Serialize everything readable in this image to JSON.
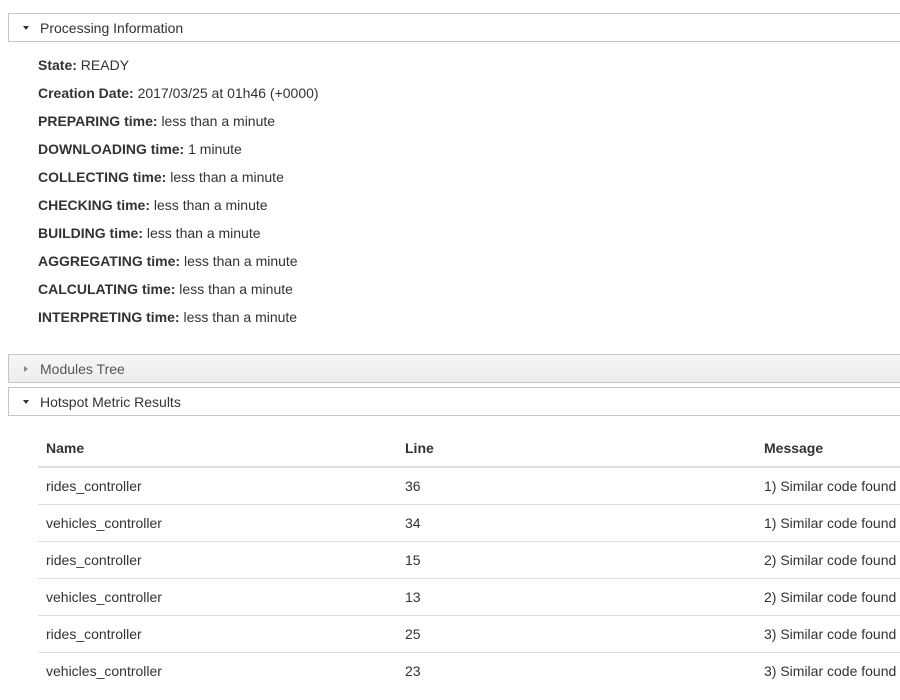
{
  "processing": {
    "title": "Processing Information",
    "rows": [
      {
        "label": "State:",
        "value": "READY"
      },
      {
        "label": "Creation Date:",
        "value": "2017/03/25 at 01h46 (+0000)"
      },
      {
        "label": "PREPARING time:",
        "value": "less than a minute"
      },
      {
        "label": "DOWNLOADING time:",
        "value": "1 minute"
      },
      {
        "label": "COLLECTING time:",
        "value": "less than a minute"
      },
      {
        "label": "CHECKING time:",
        "value": "less than a minute"
      },
      {
        "label": "BUILDING time:",
        "value": "less than a minute"
      },
      {
        "label": "AGGREGATING time:",
        "value": "less than a minute"
      },
      {
        "label": "CALCULATING time:",
        "value": "less than a minute"
      },
      {
        "label": "INTERPRETING time:",
        "value": "less than a minute"
      }
    ]
  },
  "modules_tree": {
    "title": "Modules Tree"
  },
  "hotspot": {
    "title": "Hotspot Metric Results",
    "columns": [
      "Name",
      "Line",
      "Message"
    ],
    "rows": [
      [
        "rides_controller",
        "36",
        "1) Similar code found"
      ],
      [
        "vehicles_controller",
        "34",
        "1) Similar code found"
      ],
      [
        "rides_controller",
        "15",
        "2) Similar code found"
      ],
      [
        "vehicles_controller",
        "13",
        "2) Similar code found"
      ],
      [
        "rides_controller",
        "25",
        "3) Similar code found"
      ],
      [
        "vehicles_controller",
        "23",
        "3) Similar code found"
      ]
    ]
  }
}
